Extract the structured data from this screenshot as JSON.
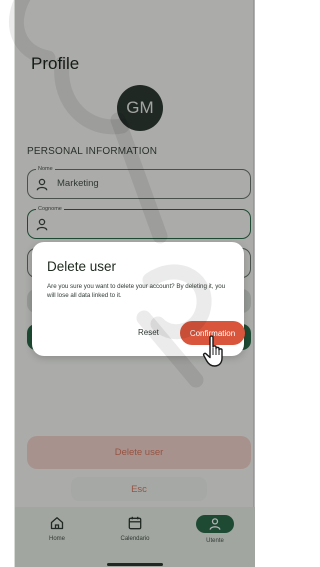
{
  "profile": {
    "title": "Profile",
    "avatar_initials": "GM",
    "section_title": "PERSONAL INFORMATION",
    "fields": [
      {
        "label": "Nome",
        "value": "Marketing",
        "icon": "person-icon"
      },
      {
        "label": "Cognome",
        "value": "",
        "icon": "person-icon"
      }
    ]
  },
  "actions": {
    "delete_user": "Delete user",
    "esc": "Esc"
  },
  "dialog": {
    "title": "Delete user",
    "message": "Are you sure you want to delete your account? By deleting it, you will lose all data linked to it.",
    "reset_label": "Reset",
    "confirm_label": "Confirmation"
  },
  "nav": {
    "items": [
      {
        "label": "Home",
        "icon": "home-icon"
      },
      {
        "label": "Calendario",
        "icon": "calendar-icon"
      },
      {
        "label": "Utente",
        "icon": "user-icon",
        "active": true
      }
    ]
  },
  "colors": {
    "primary_green": "#2c6a4a",
    "danger": "#d9553c",
    "avatar_bg": "#2f3a34"
  }
}
